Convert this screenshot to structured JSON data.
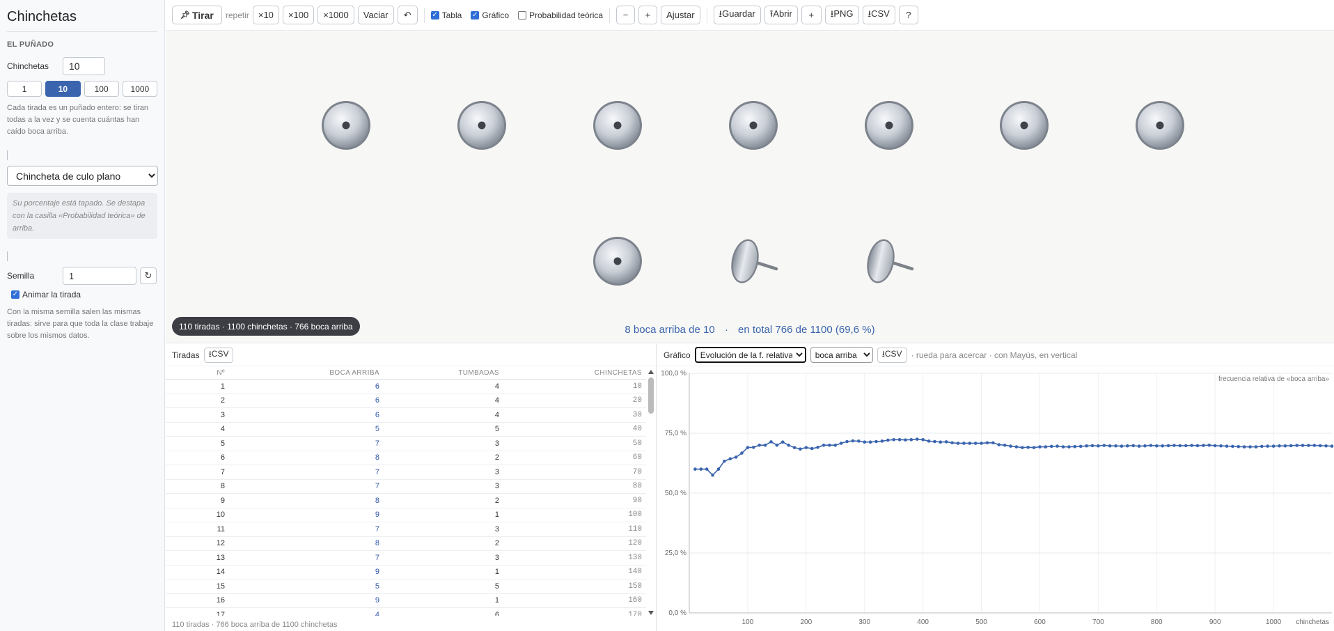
{
  "app": {
    "title": "Chinchetas"
  },
  "sidebar": {
    "section_title": "EL PUÑADO",
    "count_label": "Chinchetas",
    "count_value": "10",
    "quick": [
      {
        "label": "1",
        "active": false
      },
      {
        "label": "10",
        "active": true
      },
      {
        "label": "100",
        "active": false
      },
      {
        "label": "1000",
        "active": false
      }
    ],
    "help": "Cada tirada es un puñado entero: se tiran todas a la vez y se cuenta cuántas han caído boca arriba.",
    "tack_type": "Chincheta de culo plano",
    "note": "Su porcentaje está tapado. Se destapa con la casilla «Probabilidad teórica» de arriba.",
    "seed_label": "Semilla",
    "seed_value": "1",
    "animate_label": "Animar la tirada",
    "seed_help": "Con la misma semilla salen las mismas tiradas: sirve para que toda la clase trabaje sobre los mismos datos."
  },
  "toolbar": {
    "throw": "Tirar",
    "repeat_label": "repetir",
    "x10": "×10",
    "x100": "×100",
    "x1000": "×1000",
    "clear": "Vaciar",
    "undo": "↶",
    "table_label": "Tabla",
    "chart_label": "Gráfico",
    "theory_label": "Probabilidad teórica",
    "minus": "−",
    "plus": "+",
    "fit": "Ajustar",
    "save": "⭳Guardar",
    "open": "⭱Abrir",
    "add": "+",
    "png": "⭳PNG",
    "csv": "⭳CSV",
    "help": "?"
  },
  "stage": {
    "tacks": [
      "up",
      "up",
      "up",
      "up",
      "up",
      "up",
      "up",
      "up",
      "down",
      "down"
    ],
    "pill": "110 tiradas · 1100 chinchetas · 766 boca arriba",
    "result_main": "8 boca arriba de 10",
    "result_dot": "·",
    "result_total": "en total 766 de 1100  (69,6 %)"
  },
  "table": {
    "title": "Tiradas",
    "csv": "⭳CSV",
    "headers": [
      "Nº",
      "BOCA ARRIBA",
      "TUMBADAS",
      "CHINCHETAS"
    ],
    "rows": [
      [
        "1",
        "6",
        "4",
        "10"
      ],
      [
        "2",
        "6",
        "4",
        "20"
      ],
      [
        "3",
        "6",
        "4",
        "30"
      ],
      [
        "4",
        "5",
        "5",
        "40"
      ],
      [
        "5",
        "7",
        "3",
        "50"
      ],
      [
        "6",
        "8",
        "2",
        "60"
      ],
      [
        "7",
        "7",
        "3",
        "70"
      ],
      [
        "8",
        "7",
        "3",
        "80"
      ],
      [
        "9",
        "8",
        "2",
        "90"
      ],
      [
        "10",
        "9",
        "1",
        "100"
      ],
      [
        "11",
        "7",
        "3",
        "110"
      ],
      [
        "12",
        "8",
        "2",
        "120"
      ],
      [
        "13",
        "7",
        "3",
        "130"
      ],
      [
        "14",
        "9",
        "1",
        "140"
      ],
      [
        "15",
        "5",
        "5",
        "150"
      ],
      [
        "16",
        "9",
        "1",
        "160"
      ],
      [
        "17",
        "4",
        "6",
        "170"
      ]
    ],
    "footer": "110 tiradas · 766 boca arriba de 1100 chinchetas"
  },
  "chart_panel": {
    "title": "Gráfico",
    "mode": "Evolución de la f. relativa",
    "outcome": "boca arriba",
    "csv": "⭳CSV",
    "hint": "· rueda para acercar · con Mayús, en vertical"
  },
  "chart_data": {
    "type": "line",
    "series_label": "frecuencia relativa de «boca arriba»",
    "xlabel": "chinchetas",
    "xlim": [
      0,
      1100
    ],
    "ylim": [
      0,
      100
    ],
    "x_ticks": [
      100,
      200,
      300,
      400,
      500,
      600,
      700,
      800,
      900,
      1000
    ],
    "y_ticks": [
      0,
      25,
      50,
      75,
      100
    ],
    "y_tick_labels": [
      "0,0 %",
      "25,0 %",
      "50,0 %",
      "75,0 %",
      "100,0 %"
    ],
    "color": "#3a64ad",
    "x": [
      10,
      20,
      30,
      40,
      50,
      60,
      70,
      80,
      90,
      100,
      110,
      120,
      130,
      140,
      150,
      160,
      170,
      180,
      190,
      200,
      210,
      220,
      230,
      240,
      250,
      260,
      270,
      280,
      290,
      300,
      310,
      320,
      330,
      340,
      350,
      360,
      370,
      380,
      390,
      400,
      410,
      420,
      430,
      440,
      450,
      460,
      470,
      480,
      490,
      500,
      510,
      520,
      530,
      540,
      550,
      560,
      570,
      580,
      590,
      600,
      610,
      620,
      630,
      640,
      650,
      660,
      670,
      680,
      690,
      700,
      710,
      720,
      730,
      740,
      750,
      760,
      770,
      780,
      790,
      800,
      810,
      820,
      830,
      840,
      850,
      860,
      870,
      880,
      890,
      900,
      910,
      920,
      930,
      940,
      950,
      960,
      970,
      980,
      990,
      1000,
      1010,
      1020,
      1030,
      1040,
      1050,
      1060,
      1070,
      1080,
      1090,
      1100
    ],
    "values": [
      60,
      60,
      60,
      57.5,
      60,
      63.3,
      64.3,
      65,
      66.7,
      69,
      69.1,
      70,
      70,
      71.4,
      70,
      71.3,
      70,
      69,
      68.4,
      69,
      68.6,
      69.1,
      70,
      70,
      70,
      70.8,
      71.5,
      71.8,
      71.7,
      71.3,
      71.3,
      71.5,
      71.7,
      72.1,
      72.3,
      72.3,
      72.2,
      72.3,
      72.5,
      72.3,
      71.7,
      71.5,
      71.3,
      71.4,
      71,
      70.8,
      70.8,
      70.8,
      70.8,
      70.8,
      71,
      71,
      70.2,
      70,
      69.6,
      69.3,
      69,
      69.1,
      69,
      69.3,
      69.3,
      69.5,
      69.6,
      69.3,
      69.3,
      69.4,
      69.5,
      69.7,
      69.8,
      69.7,
      69.9,
      69.7,
      69.7,
      69.6,
      69.7,
      69.8,
      69.6,
      69.7,
      69.9,
      69.7,
      69.7,
      69.8,
      69.9,
      69.8,
      69.8,
      69.9,
      69.8,
      69.9,
      70,
      69.8,
      69.7,
      69.6,
      69.5,
      69.4,
      69.3,
      69.3,
      69.3,
      69.5,
      69.6,
      69.6,
      69.7,
      69.7,
      69.8,
      69.9,
      69.9,
      69.9,
      69.9,
      69.8,
      69.7,
      69.6
    ]
  }
}
